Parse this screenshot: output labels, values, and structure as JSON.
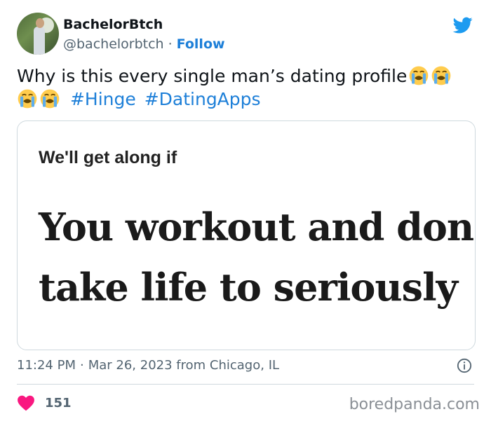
{
  "author": {
    "name": "BachelorBtch",
    "handle": "@bachelorbtch",
    "separator": "·",
    "follow_label": "Follow"
  },
  "tweet": {
    "text_main": "Why is this every single man’s dating profile",
    "hashtags": [
      "#Hinge",
      "#DatingApps"
    ],
    "emoji_name": "loudly-crying-face-icon"
  },
  "media": {
    "small_text": "We'll get along if",
    "big_line1": "You workout and don’t",
    "big_line2": "take life to seriously"
  },
  "meta": {
    "time": "11:24 PM",
    "separator": "·",
    "date": "Mar 26, 2023",
    "location": "from Chicago, IL"
  },
  "engagement": {
    "likes": "151"
  },
  "watermark": "boredpanda.com",
  "colors": {
    "accent": "#1d7fd8",
    "twitter_blue": "#1d9bf0",
    "heart": "#f91880",
    "muted": "#536471"
  }
}
